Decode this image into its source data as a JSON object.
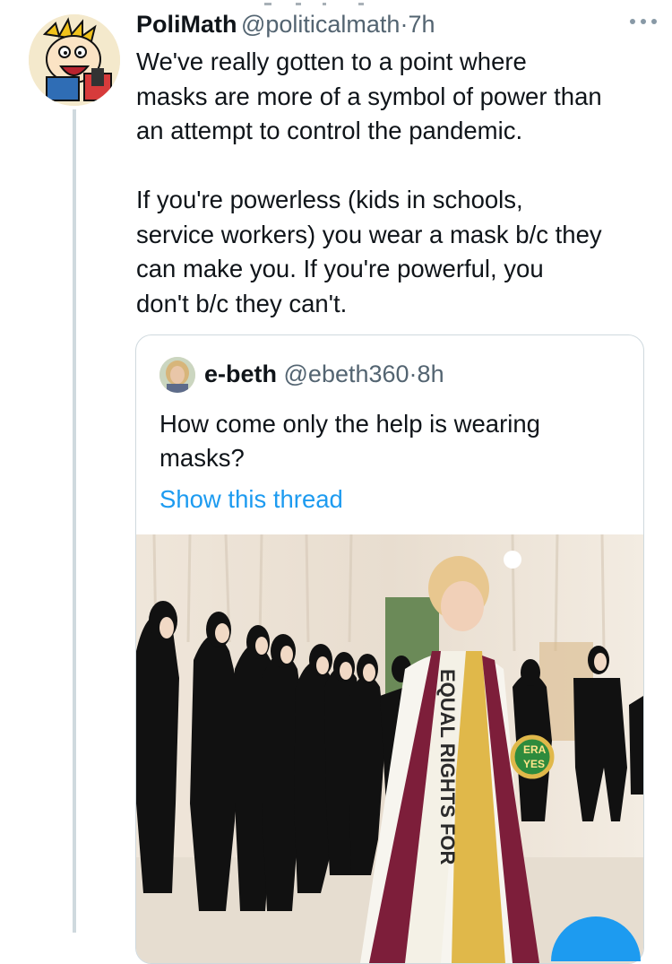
{
  "tweet": {
    "author_name": "PoliMath",
    "author_handle": "@politicalmath",
    "separator": "·",
    "time": "7h",
    "more_icon": "ellipsis-icon",
    "text": "We've really gotten to a point where\nmasks are more of a symbol of power than\nan attempt to control the pandemic.\n\nIf you're powerless (kids in schools,\nservice workers) you wear a mask b/c they\ncan make you. If you're powerful, you\ndon't b/c they can't."
  },
  "quoted_tweet": {
    "author_name": "e-beth",
    "author_handle": "@ebeth360",
    "separator": "·",
    "time": "8h",
    "text": "How come only the help is wearing\nmasks?",
    "show_thread_label": "Show this thread",
    "image": {
      "sash_text": "EQUAL RIGHTS FOR",
      "badge_text_1": "ERA",
      "badge_text_2": "YES"
    }
  },
  "colors": {
    "link": "#1d9bf0",
    "secondary_text": "#536471",
    "border": "#cfd9de"
  }
}
